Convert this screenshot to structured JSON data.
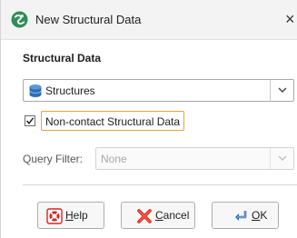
{
  "window": {
    "title": "New Structural Data",
    "close_label": "×"
  },
  "section": {
    "heading": "Structural Data"
  },
  "source_select": {
    "value": "Structures",
    "icon": "database-icon"
  },
  "non_contact": {
    "label": "Non-contact Structural Data",
    "checked": true
  },
  "query_filter": {
    "label": "Query Filter:",
    "value": "None",
    "enabled": false
  },
  "buttons": {
    "help": {
      "label_mnemonic": "H",
      "label_rest": "elp",
      "icon": "lifebuoy-icon"
    },
    "cancel": {
      "label_mnemonic": "C",
      "label_rest": "ancel",
      "icon": "red-x-icon"
    },
    "ok": {
      "label_mnemonic": "O",
      "label_rest": "K",
      "icon": "enter-arrow-icon"
    }
  },
  "colors": {
    "focus_border": "#e9a23b",
    "app_icon": "#2e8f57"
  }
}
